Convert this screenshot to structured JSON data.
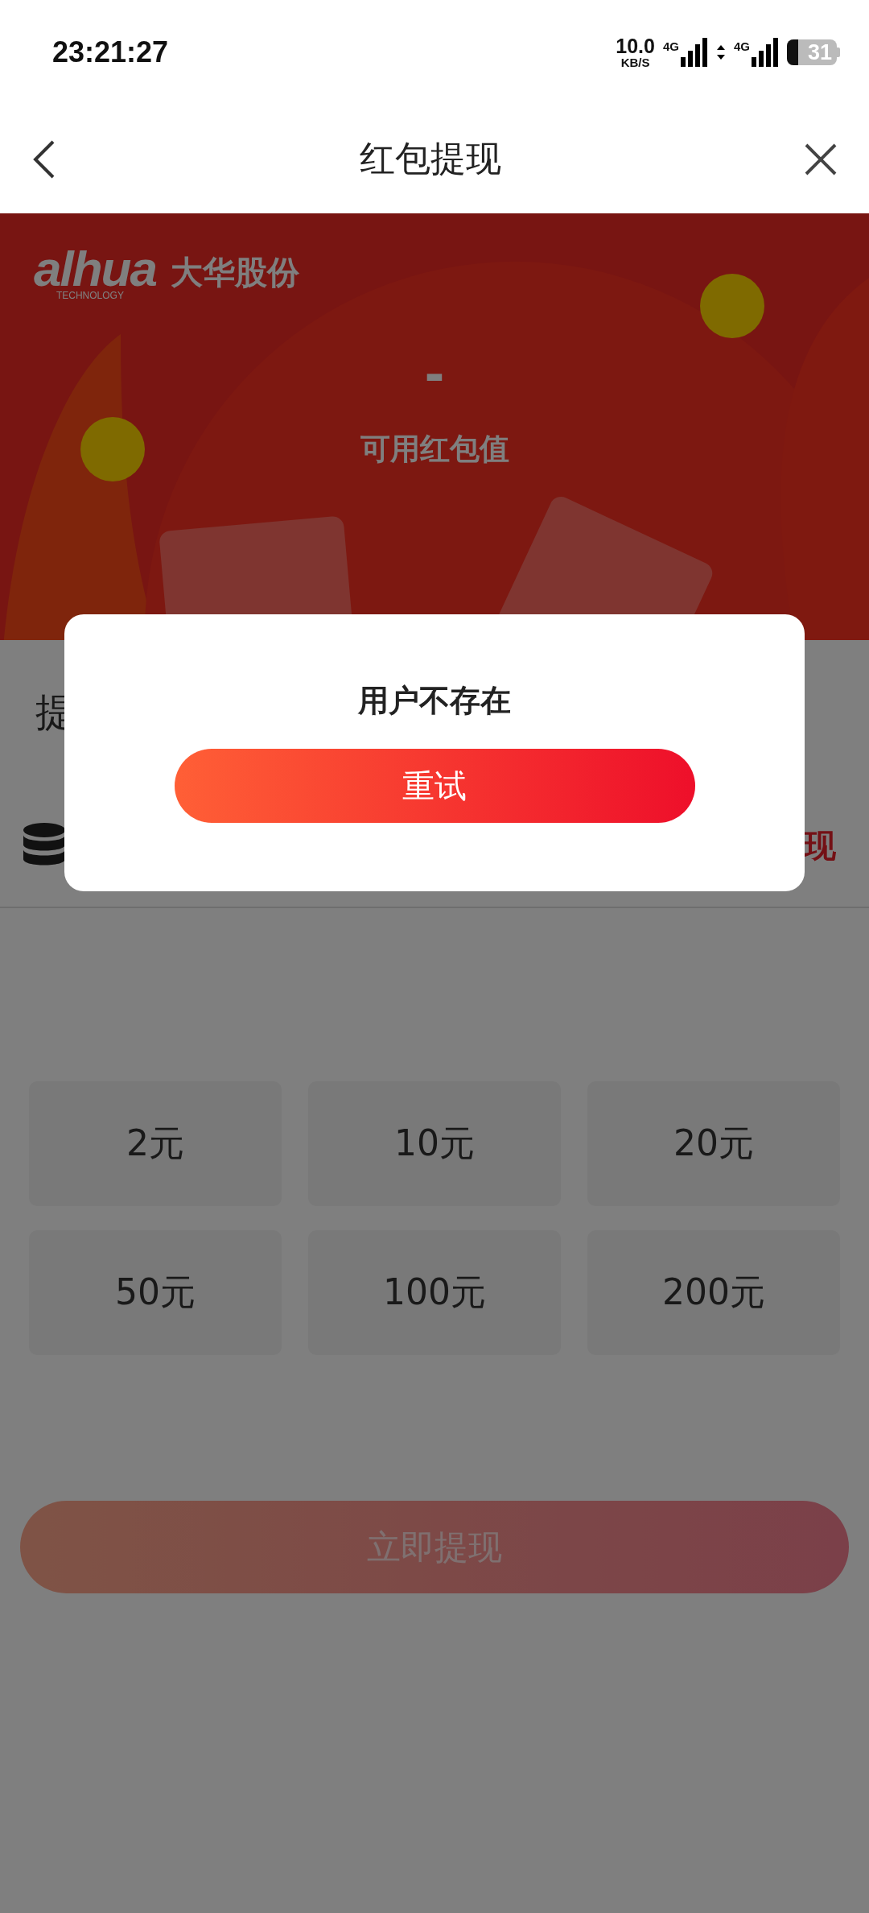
{
  "status_bar": {
    "time": "23:21:27",
    "net_speed": "10.0",
    "net_unit": "KB/S",
    "sim_1": "4G",
    "sim_2": "4G",
    "battery": "31"
  },
  "nav": {
    "title": "红包提现"
  },
  "banner": {
    "logo_wordmark": "alhua",
    "logo_tagline": "TECHNOLOGY",
    "logo_name": "大华股份",
    "balance": "-",
    "balance_label": "可用红包值"
  },
  "form": {
    "section_label": "提",
    "method_link": "现"
  },
  "amounts": [
    {
      "label": "2元",
      "selected": false
    },
    {
      "label": "10元",
      "selected": false
    },
    {
      "label": "20元",
      "selected": false
    },
    {
      "label": "50元",
      "selected": false
    },
    {
      "label": "100元",
      "selected": false
    },
    {
      "label": "200元",
      "selected": false
    }
  ],
  "submit": {
    "label": "立即提现",
    "disabled": true
  },
  "dialog": {
    "message": "用户不存在",
    "button": "重试"
  }
}
